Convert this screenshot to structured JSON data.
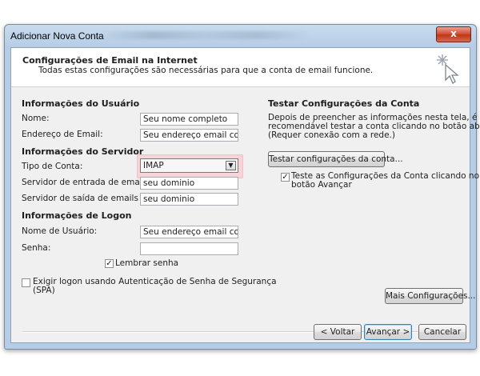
{
  "window": {
    "title": "Adicionar Nova Conta",
    "close_label": "x"
  },
  "header": {
    "title": "Configurações de Email na Internet",
    "subtitle": "Todas estas configurações são necessárias para que a conta de email funcione."
  },
  "user_info": {
    "section": "Informações do Usuário",
    "name_label": "Nome:",
    "name_value": "Seu nome completo",
    "email_label": "Endereço de Email:",
    "email_value": "Seu endereço email completo"
  },
  "server_info": {
    "section": "Informações do Servidor",
    "account_type_label": "Tipo de Conta:",
    "account_type_value": "IMAP",
    "incoming_label": "Servidor de entrada de emails:",
    "incoming_value": "seu dominio",
    "outgoing_label": "Servidor de saída de emails (SMTP):",
    "outgoing_value": "seu dominio"
  },
  "logon_info": {
    "section": "Informações de Logon",
    "username_label": "Nome de Usuário:",
    "username_value": "Seu endereço email completo",
    "password_label": "Senha:",
    "password_value": "",
    "remember_label": "Lembrar senha",
    "remember_checked": true,
    "spa_label_line1": "Exigir logon usando Autenticação de Senha de Segurança",
    "spa_label_line2": "(SPA)",
    "spa_checked": false
  },
  "test_settings": {
    "section": "Testar Configurações da Conta",
    "desc_line1": "Depois de preencher as informações nesta tela, é",
    "desc_line2": "recomendável testar a conta clicando no botão abaixo.",
    "desc_line3": "(Requer conexão com a rede.)",
    "test_button": "Testar configurações da conta...",
    "auto_test_line1": "Teste as Configurações da Conta clicando no",
    "auto_test_line2": "botão Avançar",
    "auto_test_checked": true,
    "more_settings_button": "Mais Configurações..."
  },
  "footer": {
    "back_button": "< Voltar",
    "next_button": "Avançar >",
    "cancel_button": "Cancelar"
  },
  "icons": [
    "close-icon",
    "setup-wizard-icon",
    "dropdown-arrow-icon",
    "checkbox-icon"
  ],
  "colors": {
    "title_bar": "#b5cde6",
    "close_button": "#c03618",
    "highlight": "#f6d4d8",
    "default_button_border": "#3c7fb1"
  }
}
